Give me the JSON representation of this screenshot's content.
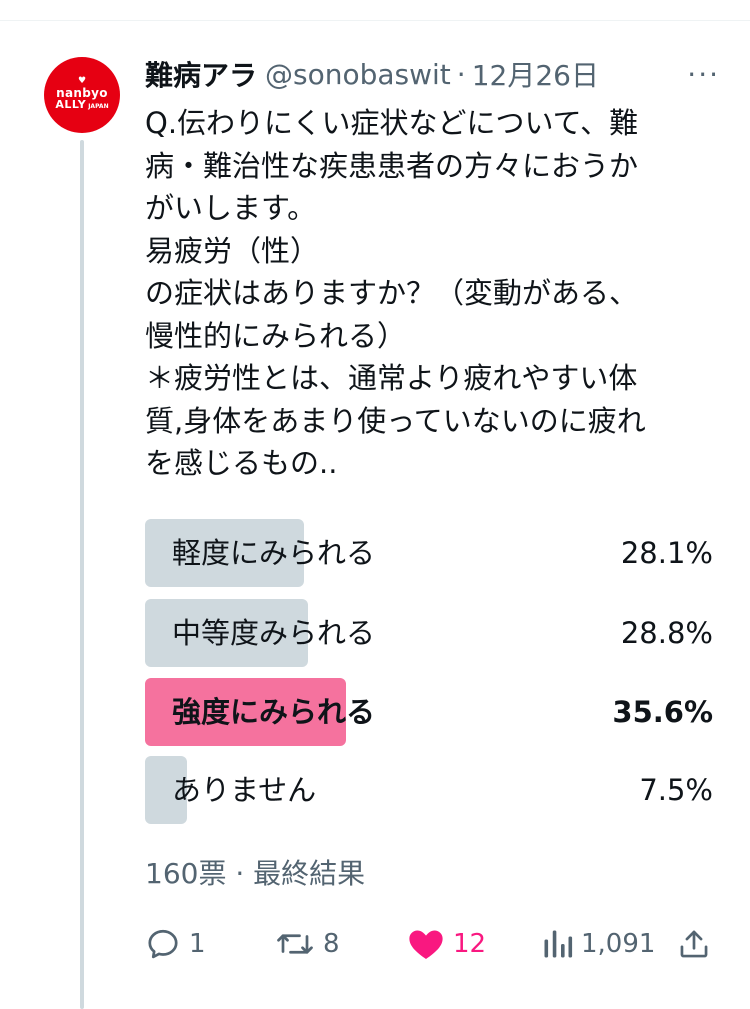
{
  "tweet": {
    "author": {
      "display_name": "難病アラ",
      "handle": "@sonobaswit",
      "avatar_text_line1": "nanbyo",
      "avatar_text_line2": "ALLY",
      "avatar_text_small": "JAPAN"
    },
    "separator": "·",
    "date": "12月26日",
    "more": "···",
    "text": "Q.伝わりにくい症状などについて、難\n病・難治性な疾患患者の方々におうか\nがいします。\n易疲労（性）\nの症状はありますか？（変動がある、\n慢性的にみられる）\n＊疲労性とは、通常より疲れやすい体\n質,身体をあまり使っていないのに疲れ\nを感じるもの..",
    "poll": {
      "options": [
        {
          "label": "軽度にみられる",
          "percent_text": "28.1%",
          "percent": 28.1,
          "winner": false
        },
        {
          "label": "中等度みられる",
          "percent_text": "28.8%",
          "percent": 28.8,
          "winner": false
        },
        {
          "label": "強度にみられる",
          "percent_text": "35.6%",
          "percent": 35.6,
          "winner": true
        },
        {
          "label": "ありません",
          "percent_text": "7.5%",
          "percent": 7.5,
          "winner": false
        }
      ],
      "meta": "160票 · 最終結果"
    },
    "actions": {
      "reply_count": "1",
      "retweet_count": "8",
      "like_count": "12",
      "view_count": "1,091"
    }
  },
  "colors": {
    "bar_default": "#cfd9de",
    "bar_winner": "#f5729e",
    "like_pink": "#f91880",
    "secondary_text": "#536471",
    "avatar_red": "#e60012"
  }
}
